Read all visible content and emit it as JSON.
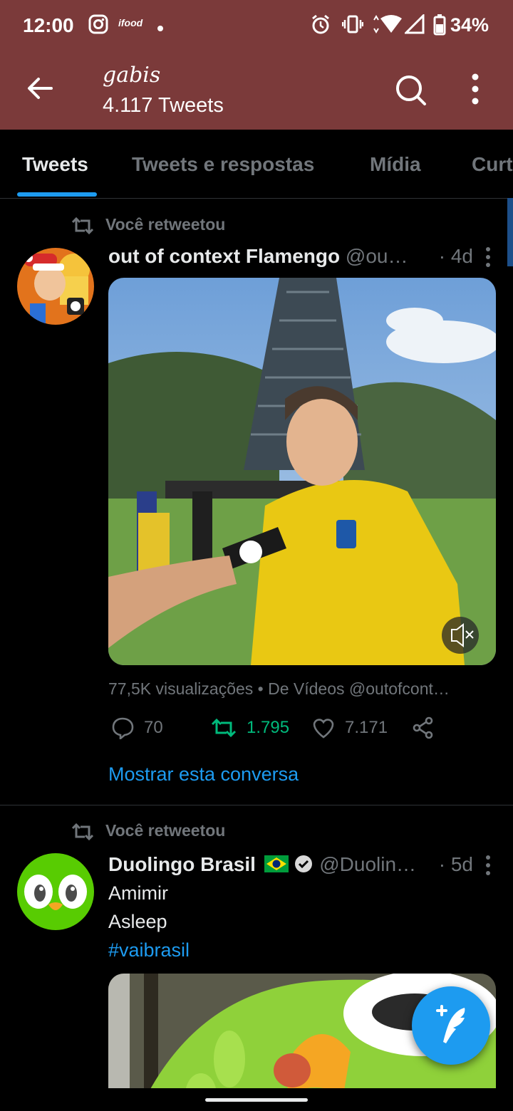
{
  "status_bar": {
    "time": "12:00",
    "battery": "34%",
    "notification_icons": [
      "instagram-icon",
      "ifood-icon",
      "dot-icon"
    ],
    "system_icons": [
      "alarm-icon",
      "vibrate-icon",
      "wifi-icon",
      "signal-icon",
      "battery-icon"
    ]
  },
  "header": {
    "name": "gabis",
    "tweet_count": "4.117 Tweets",
    "bg_color": "#7b3a3a"
  },
  "tabs": {
    "items": [
      {
        "label": "Tweets",
        "active": true
      },
      {
        "label": "Tweets e respostas",
        "active": false
      },
      {
        "label": "Mídia",
        "active": false
      },
      {
        "label": "Curt",
        "active": false
      }
    ],
    "accent": "#1d9bf0"
  },
  "tweets": [
    {
      "retweet_label": "Você retweetou",
      "display_name": "out of context Flamengo",
      "handle": "@ou…",
      "time": "· 4d",
      "views_line": "77,5K visualizações • De Vídeos @outofcont…",
      "replies": "70",
      "retweets": "1.795",
      "likes": "7.171",
      "show_conversation": "Mostrar esta conversa"
    },
    {
      "retweet_label": "Você retweetou",
      "display_name": "Duolingo Brasil",
      "handle": "@Duolin…",
      "time": "· 5d",
      "lines": [
        "Amimir",
        "Asleep"
      ],
      "hashtag": "#vaibrasil"
    }
  ],
  "colors": {
    "retweet_green": "#00ba7c",
    "link_blue": "#1d9bf0",
    "muted": "#71767b"
  }
}
